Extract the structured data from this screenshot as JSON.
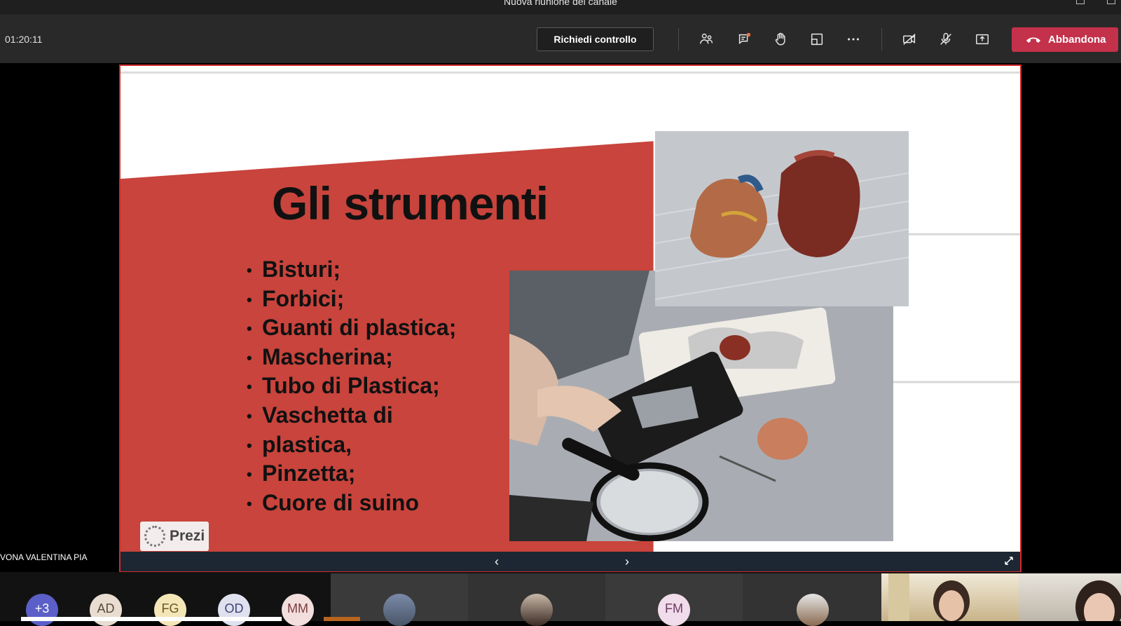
{
  "window": {
    "title": "Nuova riunione del canale"
  },
  "toolbar": {
    "timer": "01:20:11",
    "request_control_label": "Richiedi controllo",
    "leave_label": "Abbandona",
    "colors": {
      "leave": "#c4314b",
      "background": "#292929"
    }
  },
  "slide": {
    "title": "Gli strumenti",
    "bullets": [
      "Bisturi;",
      "Forbici;",
      "Guanti di plastica;",
      "Mascherina;",
      "Tubo di Plastica;",
      "Vaschetta di plastica,",
      "Pinzetta;",
      "Cuore di suino"
    ],
    "bullet_display": [
      "Bisturi;",
      "Forbici;",
      "Guanti di plastica;",
      "Mascherina;",
      "Tubo di Plastica;",
      "Vaschetta di",
      "plastica,",
      "Pinzetta;",
      "Cuore di suino"
    ],
    "prezi_label": "Prezi",
    "accent_color": "#c8443c"
  },
  "presenter": {
    "name": "VONA VALENTINA PIA"
  },
  "participants": {
    "overflow": "+3",
    "initials": [
      "AD",
      "FG",
      "OD",
      "MM",
      "FM"
    ]
  }
}
